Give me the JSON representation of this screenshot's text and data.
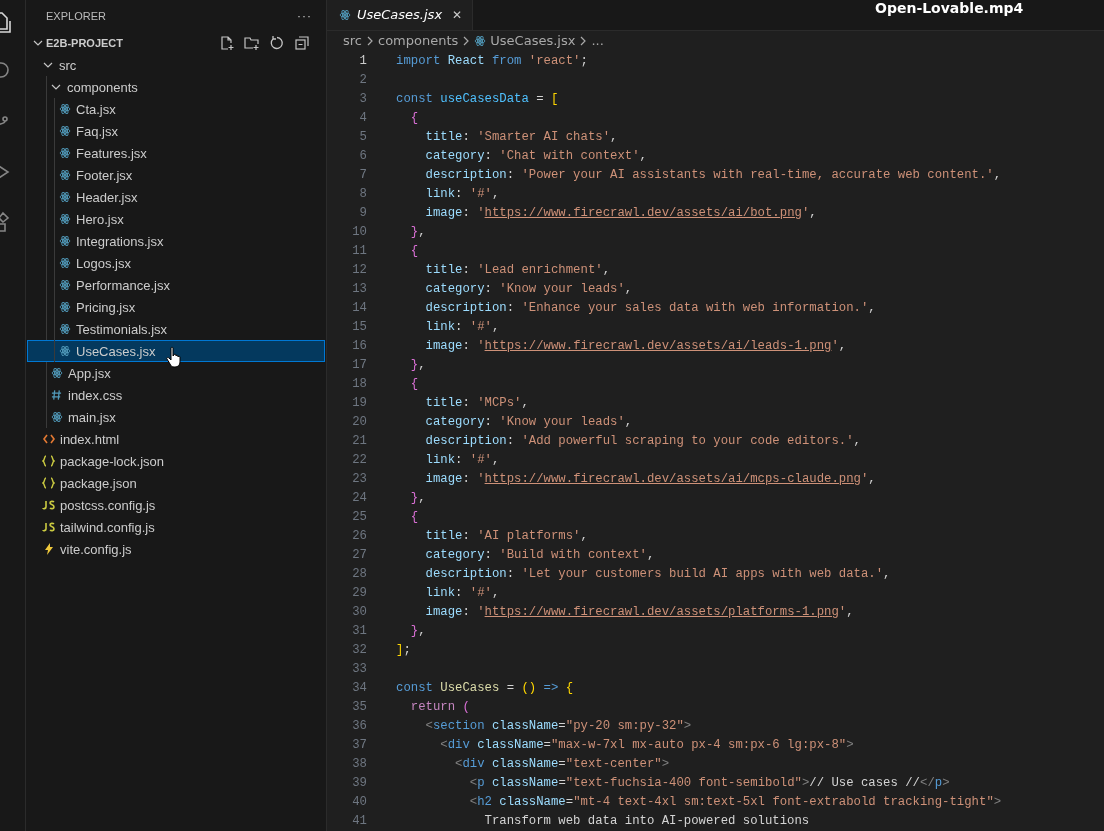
{
  "video_title": "Open-Lovable.mp4",
  "explorer": {
    "title": "EXPLORER",
    "more": "···",
    "project": {
      "label": "E2B-PROJECT",
      "expanded": true,
      "children": [
        {
          "label": "src",
          "kind": "folder",
          "expanded": true,
          "selected": false,
          "children": [
            {
              "label": "components",
              "kind": "folder",
              "expanded": true,
              "selected": false,
              "children": [
                {
                  "label": "Cta.jsx",
                  "kind": "react",
                  "selected": false
                },
                {
                  "label": "Faq.jsx",
                  "kind": "react",
                  "selected": false
                },
                {
                  "label": "Features.jsx",
                  "kind": "react",
                  "selected": false
                },
                {
                  "label": "Footer.jsx",
                  "kind": "react",
                  "selected": false
                },
                {
                  "label": "Header.jsx",
                  "kind": "react",
                  "selected": false
                },
                {
                  "label": "Hero.jsx",
                  "kind": "react",
                  "selected": false
                },
                {
                  "label": "Integrations.jsx",
                  "kind": "react",
                  "selected": false
                },
                {
                  "label": "Logos.jsx",
                  "kind": "react",
                  "selected": false
                },
                {
                  "label": "Performance.jsx",
                  "kind": "react",
                  "selected": false
                },
                {
                  "label": "Pricing.jsx",
                  "kind": "react",
                  "selected": false
                },
                {
                  "label": "Testimonials.jsx",
                  "kind": "react",
                  "selected": false
                },
                {
                  "label": "UseCases.jsx",
                  "kind": "react",
                  "selected": true
                }
              ]
            },
            {
              "label": "App.jsx",
              "kind": "react",
              "selected": false
            },
            {
              "label": "index.css",
              "kind": "css",
              "selected": false
            },
            {
              "label": "main.jsx",
              "kind": "react",
              "selected": false
            }
          ]
        },
        {
          "label": "index.html",
          "kind": "html",
          "selected": false
        },
        {
          "label": "package-lock.json",
          "kind": "json",
          "selected": false
        },
        {
          "label": "package.json",
          "kind": "json",
          "selected": false
        },
        {
          "label": "postcss.config.js",
          "kind": "js",
          "selected": false
        },
        {
          "label": "tailwind.config.js",
          "kind": "js",
          "selected": false
        },
        {
          "label": "vite.config.js",
          "kind": "vite",
          "selected": false
        }
      ]
    }
  },
  "tabs": [
    {
      "label": "UseCases.jsx",
      "kind": "react",
      "selected": true,
      "close": "✕"
    }
  ],
  "breadcrumbs": [
    {
      "label": "src",
      "kind": "folder"
    },
    {
      "label": "components",
      "kind": "folder"
    },
    {
      "label": "UseCases.jsx",
      "kind": "react"
    },
    {
      "label": "...",
      "kind": "more"
    }
  ],
  "code": [
    {
      "number": "1",
      "active": true,
      "tokens": [
        {
          "kind": "keyword",
          "text": "import "
        },
        {
          "kind": "variable",
          "text": "React"
        },
        {
          "kind": "keyword",
          "text": " from "
        },
        {
          "kind": "string",
          "text": "'react'"
        },
        {
          "kind": "plain",
          "text": ";"
        }
      ]
    },
    {
      "number": "2",
      "active": false
    },
    {
      "number": "3",
      "active": false,
      "tokens": [
        {
          "kind": "keyword",
          "text": "const "
        },
        {
          "kind": "constant",
          "text": "useCasesData"
        },
        {
          "kind": "plain",
          "text": " = "
        },
        {
          "kind": "bracket1",
          "text": "["
        }
      ]
    },
    {
      "number": "4",
      "active": false,
      "tokens": [
        {
          "kind": "bracket2",
          "text": "  {"
        }
      ]
    },
    {
      "number": "5",
      "active": false,
      "tokens": [
        {
          "kind": "variable",
          "text": "    title"
        },
        {
          "kind": "plain",
          "text": ": "
        },
        {
          "kind": "string",
          "text": "'Smarter AI chats'"
        },
        {
          "kind": "plain",
          "text": ","
        }
      ]
    },
    {
      "number": "6",
      "active": false,
      "tokens": [
        {
          "kind": "variable",
          "text": "    category"
        },
        {
          "kind": "plain",
          "text": ": "
        },
        {
          "kind": "string",
          "text": "'Chat with context'"
        },
        {
          "kind": "plain",
          "text": ","
        }
      ]
    },
    {
      "number": "7",
      "active": false,
      "tokens": [
        {
          "kind": "variable",
          "text": "    description"
        },
        {
          "kind": "plain",
          "text": ": "
        },
        {
          "kind": "string",
          "text": "'Power your AI assistants with real-time, accurate web content.'"
        },
        {
          "kind": "plain",
          "text": ","
        }
      ]
    },
    {
      "number": "8",
      "active": false,
      "tokens": [
        {
          "kind": "variable",
          "text": "    link"
        },
        {
          "kind": "plain",
          "text": ": "
        },
        {
          "kind": "string",
          "text": "'#'"
        },
        {
          "kind": "plain",
          "text": ","
        }
      ]
    },
    {
      "number": "9",
      "active": false,
      "tokens": [
        {
          "kind": "variable",
          "text": "    image"
        },
        {
          "kind": "plain",
          "text": ": "
        },
        {
          "kind": "string",
          "text": "'"
        },
        {
          "kind": "link",
          "text": "https://www.firecrawl.dev/assets/ai/bot.png"
        },
        {
          "kind": "string",
          "text": "'"
        },
        {
          "kind": "plain",
          "text": ","
        }
      ]
    },
    {
      "number": "10",
      "active": false,
      "tokens": [
        {
          "kind": "bracket2",
          "text": "  }"
        },
        {
          "kind": "plain",
          "text": ","
        }
      ]
    },
    {
      "number": "11",
      "active": false,
      "tokens": [
        {
          "kind": "bracket2",
          "text": "  {"
        }
      ]
    },
    {
      "number": "12",
      "active": false,
      "tokens": [
        {
          "kind": "variable",
          "text": "    title"
        },
        {
          "kind": "plain",
          "text": ": "
        },
        {
          "kind": "string",
          "text": "'Lead enrichment'"
        },
        {
          "kind": "plain",
          "text": ","
        }
      ]
    },
    {
      "number": "13",
      "active": false,
      "tokens": [
        {
          "kind": "variable",
          "text": "    category"
        },
        {
          "kind": "plain",
          "text": ": "
        },
        {
          "kind": "string",
          "text": "'Know your leads'"
        },
        {
          "kind": "plain",
          "text": ","
        }
      ]
    },
    {
      "number": "14",
      "active": false,
      "tokens": [
        {
          "kind": "variable",
          "text": "    description"
        },
        {
          "kind": "plain",
          "text": ": "
        },
        {
          "kind": "string",
          "text": "'Enhance your sales data with web information.'"
        },
        {
          "kind": "plain",
          "text": ","
        }
      ]
    },
    {
      "number": "15",
      "active": false,
      "tokens": [
        {
          "kind": "variable",
          "text": "    link"
        },
        {
          "kind": "plain",
          "text": ": "
        },
        {
          "kind": "string",
          "text": "'#'"
        },
        {
          "kind": "plain",
          "text": ","
        }
      ]
    },
    {
      "number": "16",
      "active": false,
      "tokens": [
        {
          "kind": "variable",
          "text": "    image"
        },
        {
          "kind": "plain",
          "text": ": "
        },
        {
          "kind": "string",
          "text": "'"
        },
        {
          "kind": "link",
          "text": "https://www.firecrawl.dev/assets/ai/leads-1.png"
        },
        {
          "kind": "string",
          "text": "'"
        },
        {
          "kind": "plain",
          "text": ","
        }
      ]
    },
    {
      "number": "17",
      "active": false,
      "tokens": [
        {
          "kind": "bracket2",
          "text": "  }"
        },
        {
          "kind": "plain",
          "text": ","
        }
      ]
    },
    {
      "number": "18",
      "active": false,
      "tokens": [
        {
          "kind": "bracket2",
          "text": "  {"
        }
      ]
    },
    {
      "number": "19",
      "active": false,
      "tokens": [
        {
          "kind": "variable",
          "text": "    title"
        },
        {
          "kind": "plain",
          "text": ": "
        },
        {
          "kind": "string",
          "text": "'MCPs'"
        },
        {
          "kind": "plain",
          "text": ","
        }
      ]
    },
    {
      "number": "20",
      "active": false,
      "tokens": [
        {
          "kind": "variable",
          "text": "    category"
        },
        {
          "kind": "plain",
          "text": ": "
        },
        {
          "kind": "string",
          "text": "'Know your leads'"
        },
        {
          "kind": "plain",
          "text": ","
        }
      ]
    },
    {
      "number": "21",
      "active": false,
      "tokens": [
        {
          "kind": "variable",
          "text": "    description"
        },
        {
          "kind": "plain",
          "text": ": "
        },
        {
          "kind": "string",
          "text": "'Add powerful scraping to your code editors.'"
        },
        {
          "kind": "plain",
          "text": ","
        }
      ]
    },
    {
      "number": "22",
      "active": false,
      "tokens": [
        {
          "kind": "variable",
          "text": "    link"
        },
        {
          "kind": "plain",
          "text": ": "
        },
        {
          "kind": "string",
          "text": "'#'"
        },
        {
          "kind": "plain",
          "text": ","
        }
      ]
    },
    {
      "number": "23",
      "active": false,
      "tokens": [
        {
          "kind": "variable",
          "text": "    image"
        },
        {
          "kind": "plain",
          "text": ": "
        },
        {
          "kind": "string",
          "text": "'"
        },
        {
          "kind": "link",
          "text": "https://www.firecrawl.dev/assets/ai/mcps-claude.png"
        },
        {
          "kind": "string",
          "text": "'"
        },
        {
          "kind": "plain",
          "text": ","
        }
      ]
    },
    {
      "number": "24",
      "active": false,
      "tokens": [
        {
          "kind": "bracket2",
          "text": "  }"
        },
        {
          "kind": "plain",
          "text": ","
        }
      ]
    },
    {
      "number": "25",
      "active": false,
      "tokens": [
        {
          "kind": "bracket2",
          "text": "  {"
        }
      ]
    },
    {
      "number": "26",
      "active": false,
      "tokens": [
        {
          "kind": "variable",
          "text": "    title"
        },
        {
          "kind": "plain",
          "text": ": "
        },
        {
          "kind": "string",
          "text": "'AI platforms'"
        },
        {
          "kind": "plain",
          "text": ","
        }
      ]
    },
    {
      "number": "27",
      "active": false,
      "tokens": [
        {
          "kind": "variable",
          "text": "    category"
        },
        {
          "kind": "plain",
          "text": ": "
        },
        {
          "kind": "string",
          "text": "'Build with context'"
        },
        {
          "kind": "plain",
          "text": ","
        }
      ]
    },
    {
      "number": "28",
      "active": false,
      "tokens": [
        {
          "kind": "variable",
          "text": "    description"
        },
        {
          "kind": "plain",
          "text": ": "
        },
        {
          "kind": "string",
          "text": "'Let your customers build AI apps with web data.'"
        },
        {
          "kind": "plain",
          "text": ","
        }
      ]
    },
    {
      "number": "29",
      "active": false,
      "tokens": [
        {
          "kind": "variable",
          "text": "    link"
        },
        {
          "kind": "plain",
          "text": ": "
        },
        {
          "kind": "string",
          "text": "'#'"
        },
        {
          "kind": "plain",
          "text": ","
        }
      ]
    },
    {
      "number": "30",
      "active": false,
      "tokens": [
        {
          "kind": "variable",
          "text": "    image"
        },
        {
          "kind": "plain",
          "text": ": "
        },
        {
          "kind": "string",
          "text": "'"
        },
        {
          "kind": "link",
          "text": "https://www.firecrawl.dev/assets/platforms-1.png"
        },
        {
          "kind": "string",
          "text": "'"
        },
        {
          "kind": "plain",
          "text": ","
        }
      ]
    },
    {
      "number": "31",
      "active": false,
      "tokens": [
        {
          "kind": "bracket2",
          "text": "  }"
        },
        {
          "kind": "plain",
          "text": ","
        }
      ]
    },
    {
      "number": "32",
      "active": false,
      "tokens": [
        {
          "kind": "bracket1",
          "text": "]"
        },
        {
          "kind": "plain",
          "text": ";"
        }
      ]
    },
    {
      "number": "33",
      "active": false
    },
    {
      "number": "34",
      "active": false,
      "tokens": [
        {
          "kind": "keyword",
          "text": "const "
        },
        {
          "kind": "function",
          "text": "UseCases"
        },
        {
          "kind": "plain",
          "text": " = "
        },
        {
          "kind": "bracket1",
          "text": "()"
        },
        {
          "kind": "keyword",
          "text": " => "
        },
        {
          "kind": "bracket1",
          "text": "{"
        }
      ]
    },
    {
      "number": "35",
      "active": false,
      "tokens": [
        {
          "kind": "control",
          "text": "  return "
        },
        {
          "kind": "bracket2",
          "text": "("
        }
      ]
    },
    {
      "number": "36",
      "active": false,
      "tokens": [
        {
          "kind": "angle",
          "text": "    <"
        },
        {
          "kind": "tag",
          "text": "section"
        },
        {
          "kind": "variable",
          "text": " className"
        },
        {
          "kind": "plain",
          "text": "="
        },
        {
          "kind": "string",
          "text": "\"py-20 sm:py-32\""
        },
        {
          "kind": "angle",
          "text": ">"
        }
      ]
    },
    {
      "number": "37",
      "active": false,
      "tokens": [
        {
          "kind": "angle",
          "text": "      <"
        },
        {
          "kind": "tag",
          "text": "div"
        },
        {
          "kind": "variable",
          "text": " className"
        },
        {
          "kind": "plain",
          "text": "="
        },
        {
          "kind": "string",
          "text": "\"max-w-7xl mx-auto px-4 sm:px-6 lg:px-8\""
        },
        {
          "kind": "angle",
          "text": ">"
        }
      ]
    },
    {
      "number": "38",
      "active": false,
      "tokens": [
        {
          "kind": "angle",
          "text": "        <"
        },
        {
          "kind": "tag",
          "text": "div"
        },
        {
          "kind": "variable",
          "text": " className"
        },
        {
          "kind": "plain",
          "text": "="
        },
        {
          "kind": "string",
          "text": "\"text-center\""
        },
        {
          "kind": "angle",
          "text": ">"
        }
      ]
    },
    {
      "number": "39",
      "active": false,
      "tokens": [
        {
          "kind": "angle",
          "text": "          <"
        },
        {
          "kind": "tag",
          "text": "p"
        },
        {
          "kind": "variable",
          "text": " className"
        },
        {
          "kind": "plain",
          "text": "="
        },
        {
          "kind": "string",
          "text": "\"text-fuchsia-400 font-semibold\""
        },
        {
          "kind": "angle",
          "text": ">"
        },
        {
          "kind": "plain",
          "text": "// Use cases //"
        },
        {
          "kind": "angle",
          "text": "</"
        },
        {
          "kind": "tag",
          "text": "p"
        },
        {
          "kind": "angle",
          "text": ">"
        }
      ]
    },
    {
      "number": "40",
      "active": false,
      "tokens": [
        {
          "kind": "angle",
          "text": "          <"
        },
        {
          "kind": "tag",
          "text": "h2"
        },
        {
          "kind": "variable",
          "text": " className"
        },
        {
          "kind": "plain",
          "text": "="
        },
        {
          "kind": "string",
          "text": "\"mt-4 text-4xl sm:text-5xl font-extrabold tracking-tight\""
        },
        {
          "kind": "angle",
          "text": ">"
        }
      ]
    },
    {
      "number": "41",
      "active": false,
      "tokens": [
        {
          "kind": "plain",
          "text": "            Transform web data into AI-powered solutions"
        }
      ]
    }
  ]
}
